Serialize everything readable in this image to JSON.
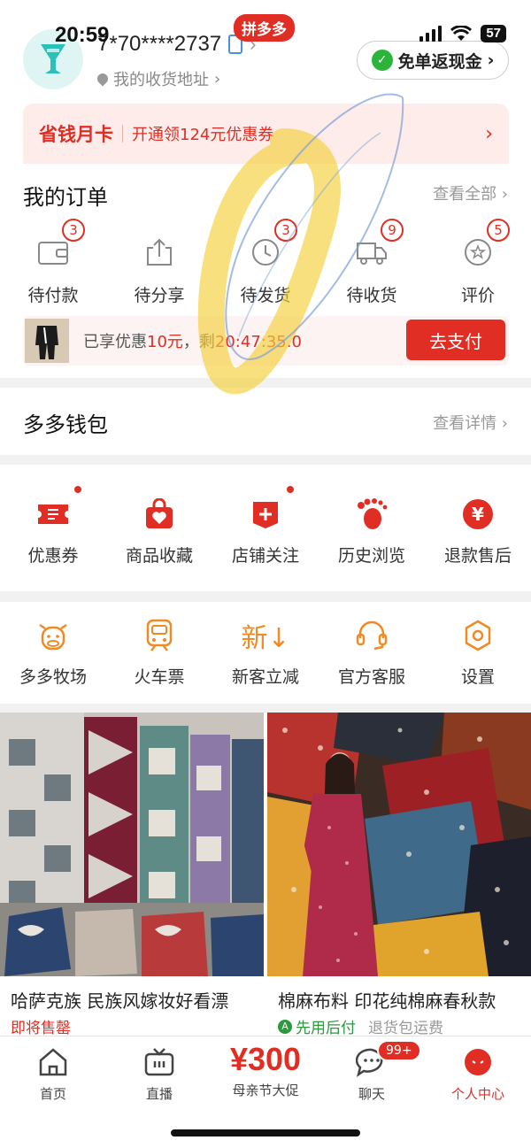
{
  "status_bar": {
    "time": "20:59",
    "battery": "57"
  },
  "header": {
    "phone": "7*70****2737",
    "app_badge": "拼多多",
    "address": "我的收货地址",
    "cash_button": "免单返现金"
  },
  "savecard": {
    "title": "省钱月卡",
    "desc": "开通领124元优惠券"
  },
  "orders": {
    "title": "我的订单",
    "view_all": "查看全部",
    "items": [
      {
        "label": "待付款",
        "count": "3",
        "icon": "wallet-icon"
      },
      {
        "label": "待分享",
        "count": "",
        "icon": "share-icon"
      },
      {
        "label": "待发货",
        "count": "3",
        "icon": "clock-icon"
      },
      {
        "label": "待收货",
        "count": "9",
        "icon": "truck-icon"
      },
      {
        "label": "评价",
        "count": "5",
        "icon": "review-icon"
      }
    ],
    "pending": {
      "text_prefix": "已享优惠",
      "discount": "10元",
      "text_mid": "，剩",
      "countdown": "20:47:35.0",
      "pay_button": "去支付"
    }
  },
  "wallet": {
    "title": "多多钱包",
    "link": "查看详情"
  },
  "services": [
    {
      "label": "优惠券",
      "icon": "coupon-icon",
      "dot": true
    },
    {
      "label": "商品收藏",
      "icon": "favorites-bag-icon",
      "dot": false
    },
    {
      "label": "店铺关注",
      "icon": "shop-follow-icon",
      "dot": true
    },
    {
      "label": "历史浏览",
      "icon": "footprint-icon",
      "dot": false
    },
    {
      "label": "退款售后",
      "icon": "refund-icon",
      "dot": false
    }
  ],
  "tools": [
    {
      "label": "多多牧场",
      "icon": "cow-icon"
    },
    {
      "label": "火车票",
      "icon": "train-icon"
    },
    {
      "label": "新客立减",
      "icon": "new-discount-icon",
      "glyph": "新↓"
    },
    {
      "label": "官方客服",
      "icon": "headset-icon"
    },
    {
      "label": "设置",
      "icon": "settings-icon"
    }
  ],
  "products": [
    {
      "name": "哈萨克族 民族风嫁妆好看漂",
      "tag": "即将售罄"
    },
    {
      "name": "棉麻布料 印花纯棉麻春秋款",
      "tag": "先用后付",
      "tag_extra": "退货包运费"
    }
  ],
  "tabbar": {
    "items": [
      {
        "label": "首页",
        "icon": "home-icon"
      },
      {
        "label": "直播",
        "icon": "live-tv-icon"
      },
      {
        "label": "母亲节大促",
        "big": "¥300"
      },
      {
        "label": "聊天",
        "icon": "chat-icon",
        "badge": "99+"
      },
      {
        "label": "个人中心",
        "icon": "profile-icon",
        "active": true
      }
    ]
  },
  "colors": {
    "brand_red": "#e02e24",
    "orange": "#f08a24",
    "green": "#2a9a3c"
  }
}
